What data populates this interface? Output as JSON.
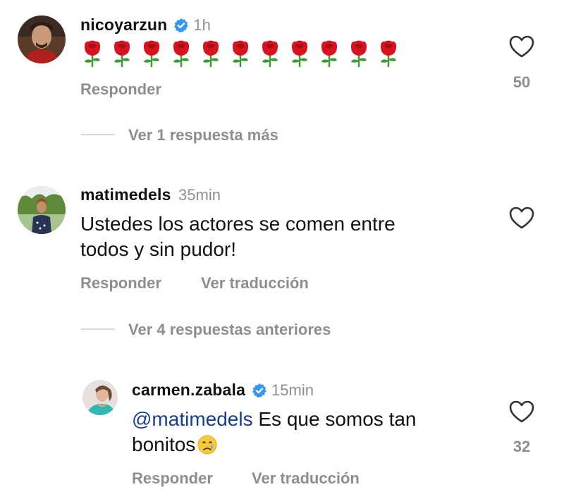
{
  "colors": {
    "verified": "#3897f0",
    "muted": "#8e8e8e",
    "mention": "#1a3d8f",
    "rose_petal": "#d6131f",
    "rose_leaf": "#3a9b34"
  },
  "thread": {
    "see_more_replies_1": "Ver 1 respuesta más",
    "see_previous_replies": "Ver 4 respuestas anteriores"
  },
  "comments": [
    {
      "username": "nicoyarzun",
      "verified": true,
      "time": "1h",
      "content_icons": [
        "rose-icon",
        "rose-icon",
        "rose-icon",
        "rose-icon",
        "rose-icon",
        "rose-icon",
        "rose-icon",
        "rose-icon",
        "rose-icon",
        "rose-icon",
        "rose-icon"
      ],
      "reply_label": "Responder",
      "like_icon": "heart-outline-icon",
      "likes": "50"
    },
    {
      "username": "matimedels",
      "verified": false,
      "time": "35min",
      "text_line1": "Ustedes los actores se comen entre",
      "text_line2": "todos y sin pudor!",
      "reply_label": "Responder",
      "translate_label": "Ver traducción",
      "like_icon": "heart-outline-icon"
    },
    {
      "username": "carmen.zabala",
      "verified": true,
      "time": "15min",
      "mention": "@matimedels",
      "text_rest_line1": " Es que somos tan",
      "text_line2": "bonitos",
      "emoji": "crying-face-icon",
      "reply_label": "Responder",
      "translate_label": "Ver traducción",
      "like_icon": "heart-outline-icon",
      "likes": "32"
    }
  ]
}
